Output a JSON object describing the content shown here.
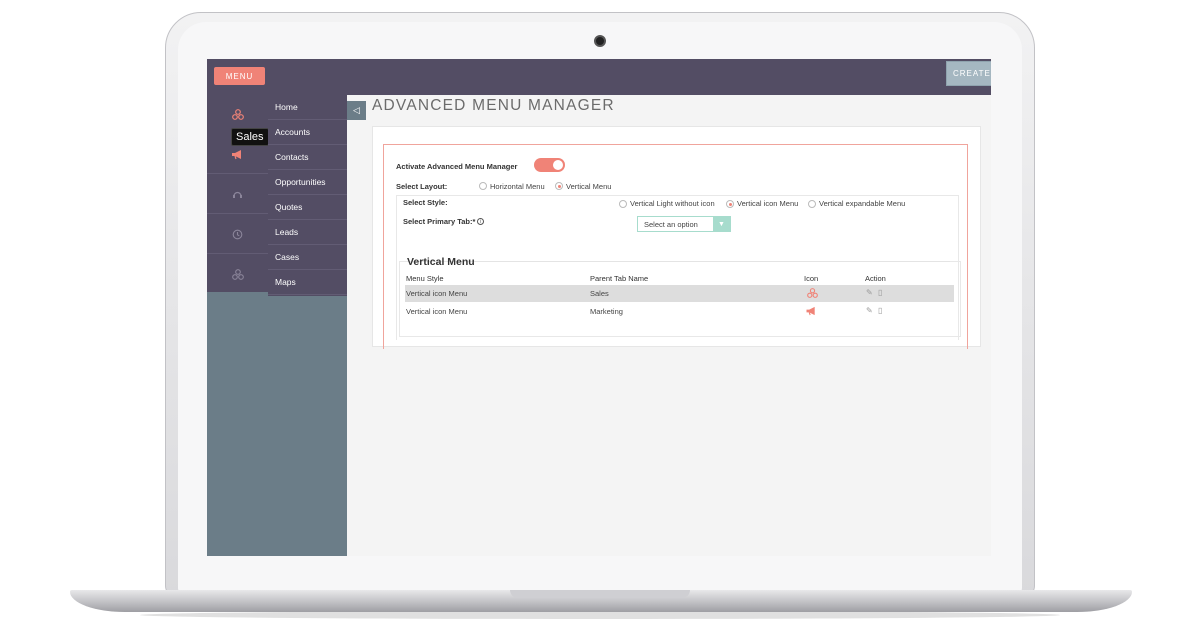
{
  "topbar": {
    "menu_label": "MENU",
    "create_label": "CREATE"
  },
  "sidebar": {
    "tooltip": "Sales",
    "icons": [
      "sales-icon",
      "megaphone-icon",
      "headset-icon",
      "clock-icon",
      "network-icon"
    ],
    "items": [
      {
        "label": "Home"
      },
      {
        "label": "Accounts"
      },
      {
        "label": "Contacts"
      },
      {
        "label": "Opportunities"
      },
      {
        "label": "Quotes"
      },
      {
        "label": "Leads"
      },
      {
        "label": "Cases"
      },
      {
        "label": "Maps"
      }
    ]
  },
  "page": {
    "title": "ADVANCED MENU MANAGER",
    "collapse_icon": "◁"
  },
  "form": {
    "activate_label": "Activate Advanced Menu Manager",
    "activate_on": true,
    "layout_label": "Select Layout:",
    "layout_options": [
      "Horizontal Menu",
      "Vertical Menu"
    ],
    "layout_selected": "Vertical Menu",
    "style_label": "Select Style:",
    "style_options": [
      "Vertical Light without icon",
      "Vertical icon Menu",
      "Vertical expandable Menu"
    ],
    "style_selected": "Vertical icon Menu",
    "primary_tab_label": "Select Primary Tab:*",
    "primary_tab_value": "Select an option"
  },
  "vertical_menu": {
    "title": "Vertical Menu",
    "columns": [
      "Menu Style",
      "Parent Tab Name",
      "Icon",
      "Action"
    ],
    "rows": [
      {
        "style": "Vertical icon Menu",
        "parent": "Sales",
        "icon": "sales-icon"
      },
      {
        "style": "Vertical icon Menu",
        "parent": "Marketing",
        "icon": "megaphone-icon"
      }
    ]
  },
  "colors": {
    "accent": "#f08377",
    "nav": "#534d64",
    "sidebar_bg": "#6b7d88",
    "select_accent": "#a7dccd"
  }
}
